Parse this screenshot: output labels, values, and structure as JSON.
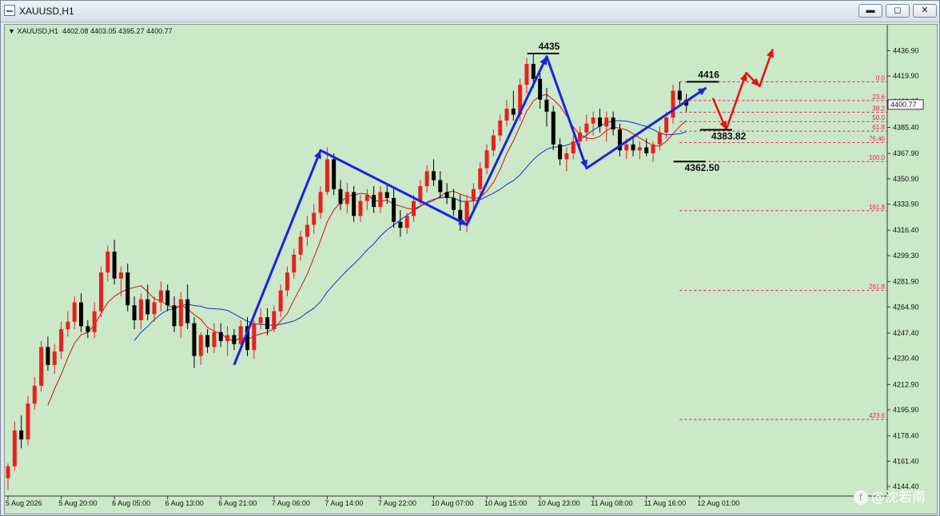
{
  "window": {
    "title": "XAUUSD,H1",
    "buttons": {
      "minimize": "▬",
      "maximize": "◻",
      "close": "✕"
    }
  },
  "chart_header": {
    "marker": "▼",
    "symbol": "XAUUSD,H1",
    "ohlc": "4402.08 4403.05 4395.27 4400.77"
  },
  "watermark": {
    "badge": "f",
    "text": "@沈若南"
  },
  "colors": {
    "background": "#cbe8c8",
    "bull": "#e8201f",
    "bear": "#000000",
    "ma_fast": "#d41010",
    "ma_slow": "#1030d0",
    "wave": "#1a22e0",
    "projection": "#e81010",
    "fib": "#e8205a"
  },
  "chart_data": {
    "type": "candlestick",
    "symbol": "XAUUSD",
    "timeframe": "H1",
    "ylim": [
      4138,
      4450
    ],
    "y_ticks": [
      "4436.90",
      "4419.90",
      "4402.85",
      "4385.40",
      "4367.90",
      "4350.90",
      "4333.90",
      "4316.40",
      "4299.30",
      "4281.90",
      "4264.90",
      "4247.40",
      "4230.40",
      "4212.90",
      "4195.90",
      "4178.40",
      "4161.40",
      "4144.40"
    ],
    "x_labels": [
      {
        "i": 0,
        "label": "5 Aug 2026"
      },
      {
        "i": 8,
        "label": "5 Aug 20:00"
      },
      {
        "i": 16,
        "label": "6 Aug 05:00"
      },
      {
        "i": 24,
        "label": "6 Aug 13:00"
      },
      {
        "i": 32,
        "label": "6 Aug 21:00"
      },
      {
        "i": 40,
        "label": "7 Aug 06:00"
      },
      {
        "i": 48,
        "label": "7 Aug 14:00"
      },
      {
        "i": 56,
        "label": "7 Aug 22:00"
      },
      {
        "i": 64,
        "label": "10 Aug 07:00"
      },
      {
        "i": 72,
        "label": "10 Aug 15:00"
      },
      {
        "i": 80,
        "label": "10 Aug 23:00"
      },
      {
        "i": 88,
        "label": "11 Aug 08:00"
      },
      {
        "i": 96,
        "label": "11 Aug 16:00"
      },
      {
        "i": 104,
        "label": "12 Aug 01:00"
      }
    ],
    "candles": [
      [
        4150,
        4160,
        4142,
        4158
      ],
      [
        4158,
        4188,
        4155,
        4182
      ],
      [
        4182,
        4192,
        4170,
        4176
      ],
      [
        4176,
        4205,
        4172,
        4200
      ],
      [
        4200,
        4218,
        4196,
        4212
      ],
      [
        4212,
        4242,
        4208,
        4238
      ],
      [
        4238,
        4245,
        4222,
        4226
      ],
      [
        4226,
        4240,
        4220,
        4235
      ],
      [
        4235,
        4255,
        4230,
        4250
      ],
      [
        4250,
        4262,
        4245,
        4255
      ],
      [
        4255,
        4272,
        4250,
        4268
      ],
      [
        4268,
        4274,
        4248,
        4252
      ],
      [
        4252,
        4256,
        4244,
        4248
      ],
      [
        4248,
        4268,
        4244,
        4262
      ],
      [
        4262,
        4292,
        4258,
        4288
      ],
      [
        4288,
        4306,
        4282,
        4302
      ],
      [
        4302,
        4310,
        4280,
        4284
      ],
      [
        4284,
        4292,
        4272,
        4288
      ],
      [
        4288,
        4294,
        4262,
        4266
      ],
      [
        4266,
        4272,
        4250,
        4256
      ],
      [
        4256,
        4274,
        4250,
        4270
      ],
      [
        4270,
        4280,
        4256,
        4260
      ],
      [
        4260,
        4272,
        4255,
        4268
      ],
      [
        4268,
        4282,
        4262,
        4276
      ],
      [
        4276,
        4280,
        4262,
        4266
      ],
      [
        4266,
        4272,
        4248,
        4252
      ],
      [
        4252,
        4275,
        4244,
        4270
      ],
      [
        4270,
        4280,
        4250,
        4254
      ],
      [
        4254,
        4258,
        4224,
        4232
      ],
      [
        4232,
        4248,
        4226,
        4246
      ],
      [
        4246,
        4250,
        4234,
        4238
      ],
      [
        4238,
        4254,
        4234,
        4248
      ],
      [
        4248,
        4254,
        4238,
        4242
      ],
      [
        4242,
        4252,
        4232,
        4246
      ],
      [
        4246,
        4250,
        4236,
        4240
      ],
      [
        4240,
        4256,
        4236,
        4252
      ],
      [
        4252,
        4258,
        4232,
        4236
      ],
      [
        4236,
        4256,
        4230,
        4254
      ],
      [
        4254,
        4264,
        4250,
        4258
      ],
      [
        4258,
        4264,
        4246,
        4250
      ],
      [
        4250,
        4266,
        4248,
        4262
      ],
      [
        4262,
        4280,
        4258,
        4276
      ],
      [
        4276,
        4292,
        4272,
        4288
      ],
      [
        4288,
        4304,
        4284,
        4300
      ],
      [
        4300,
        4316,
        4296,
        4312
      ],
      [
        4312,
        4326,
        4306,
        4320
      ],
      [
        4320,
        4334,
        4314,
        4328
      ],
      [
        4328,
        4346,
        4324,
        4342
      ],
      [
        4342,
        4372,
        4340,
        4364
      ],
      [
        4364,
        4368,
        4340,
        4344
      ],
      [
        4344,
        4350,
        4330,
        4334
      ],
      [
        4334,
        4348,
        4328,
        4342
      ],
      [
        4342,
        4346,
        4322,
        4326
      ],
      [
        4326,
        4340,
        4322,
        4336
      ],
      [
        4336,
        4344,
        4330,
        4340
      ],
      [
        4340,
        4346,
        4328,
        4332
      ],
      [
        4332,
        4346,
        4328,
        4342
      ],
      [
        4342,
        4348,
        4334,
        4338
      ],
      [
        4338,
        4344,
        4318,
        4322
      ],
      [
        4322,
        4330,
        4312,
        4318
      ],
      [
        4318,
        4328,
        4314,
        4326
      ],
      [
        4326,
        4340,
        4322,
        4336
      ],
      [
        4336,
        4350,
        4332,
        4346
      ],
      [
        4346,
        4360,
        4342,
        4356
      ],
      [
        4356,
        4364,
        4346,
        4350
      ],
      [
        4350,
        4356,
        4338,
        4342
      ],
      [
        4342,
        4348,
        4334,
        4338
      ],
      [
        4338,
        4344,
        4326,
        4330
      ],
      [
        4330,
        4340,
        4316,
        4322
      ],
      [
        4322,
        4340,
        4315,
        4336
      ],
      [
        4336,
        4348,
        4330,
        4344
      ],
      [
        4344,
        4362,
        4340,
        4358
      ],
      [
        4358,
        4374,
        4354,
        4370
      ],
      [
        4370,
        4384,
        4366,
        4380
      ],
      [
        4380,
        4394,
        4376,
        4390
      ],
      [
        4390,
        4404,
        4386,
        4398
      ],
      [
        4398,
        4410,
        4390,
        4394
      ],
      [
        4394,
        4418,
        4390,
        4414
      ],
      [
        4414,
        4432,
        4408,
        4428
      ],
      [
        4428,
        4435,
        4412,
        4418
      ],
      [
        4418,
        4422,
        4398,
        4404
      ],
      [
        4404,
        4412,
        4386,
        4396
      ],
      [
        4396,
        4400,
        4370,
        4374
      ],
      [
        4374,
        4378,
        4360,
        4364
      ],
      [
        4364,
        4372,
        4356,
        4368
      ],
      [
        4368,
        4380,
        4364,
        4376
      ],
      [
        4376,
        4386,
        4370,
        4382
      ],
      [
        4382,
        4394,
        4376,
        4388
      ],
      [
        4388,
        4396,
        4380,
        4392
      ],
      [
        4392,
        4398,
        4382,
        4386
      ],
      [
        4386,
        4396,
        4376,
        4392
      ],
      [
        4392,
        4396,
        4380,
        4384
      ],
      [
        4384,
        4388,
        4366,
        4370
      ],
      [
        4370,
        4378,
        4364,
        4374
      ],
      [
        4374,
        4378,
        4366,
        4370
      ],
      [
        4370,
        4376,
        4364,
        4372
      ],
      [
        4372,
        4378,
        4366,
        4368
      ],
      [
        4368,
        4376,
        4362,
        4374
      ],
      [
        4374,
        4386,
        4370,
        4382
      ],
      [
        4382,
        4396,
        4378,
        4392
      ],
      [
        4392,
        4414,
        4388,
        4410
      ],
      [
        4410,
        4416,
        4400,
        4404
      ],
      [
        4404,
        4408,
        4396,
        4400
      ]
    ],
    "series": [],
    "annotations": [
      {
        "text": "4435",
        "value": 4435,
        "at": 80
      },
      {
        "text": "4416",
        "value": 4416,
        "at": 104
      },
      {
        "text": "4383.82",
        "value": 4383.82,
        "at": 106
      },
      {
        "text": "4362.50",
        "value": 4362.5,
        "at": 102
      }
    ],
    "wave_points": [
      [
        34,
        4226
      ],
      [
        47,
        4370
      ],
      [
        69,
        4320
      ],
      [
        81,
        4433
      ],
      [
        87,
        4358
      ],
      [
        105,
        4412
      ]
    ],
    "projection_points": [
      [
        106,
        4405
      ],
      [
        108,
        4384
      ],
      [
        111,
        4422
      ],
      [
        113,
        4413
      ],
      [
        115,
        4438
      ]
    ],
    "fibonacci": {
      "start_index": 101,
      "levels": [
        {
          "label": "0.0",
          "value": 4416
        },
        {
          "label": "23.6",
          "value": 4403.4
        },
        {
          "label": "38.2",
          "value": 4395.6
        },
        {
          "label": "50.0",
          "value": 4389.3
        },
        {
          "label": "61.8",
          "value": 4382.9
        },
        {
          "label": "76.40",
          "value": 4375.2
        },
        {
          "label": "100.0",
          "value": 4362.5
        },
        {
          "label": "161.8",
          "value": 4329.5
        },
        {
          "label": "261.8",
          "value": 4276.0
        },
        {
          "label": "423.6",
          "value": 4189.4
        }
      ]
    },
    "last_price": "4400.77",
    "grid": false,
    "title": "",
    "xlabel": "",
    "ylabel": ""
  }
}
